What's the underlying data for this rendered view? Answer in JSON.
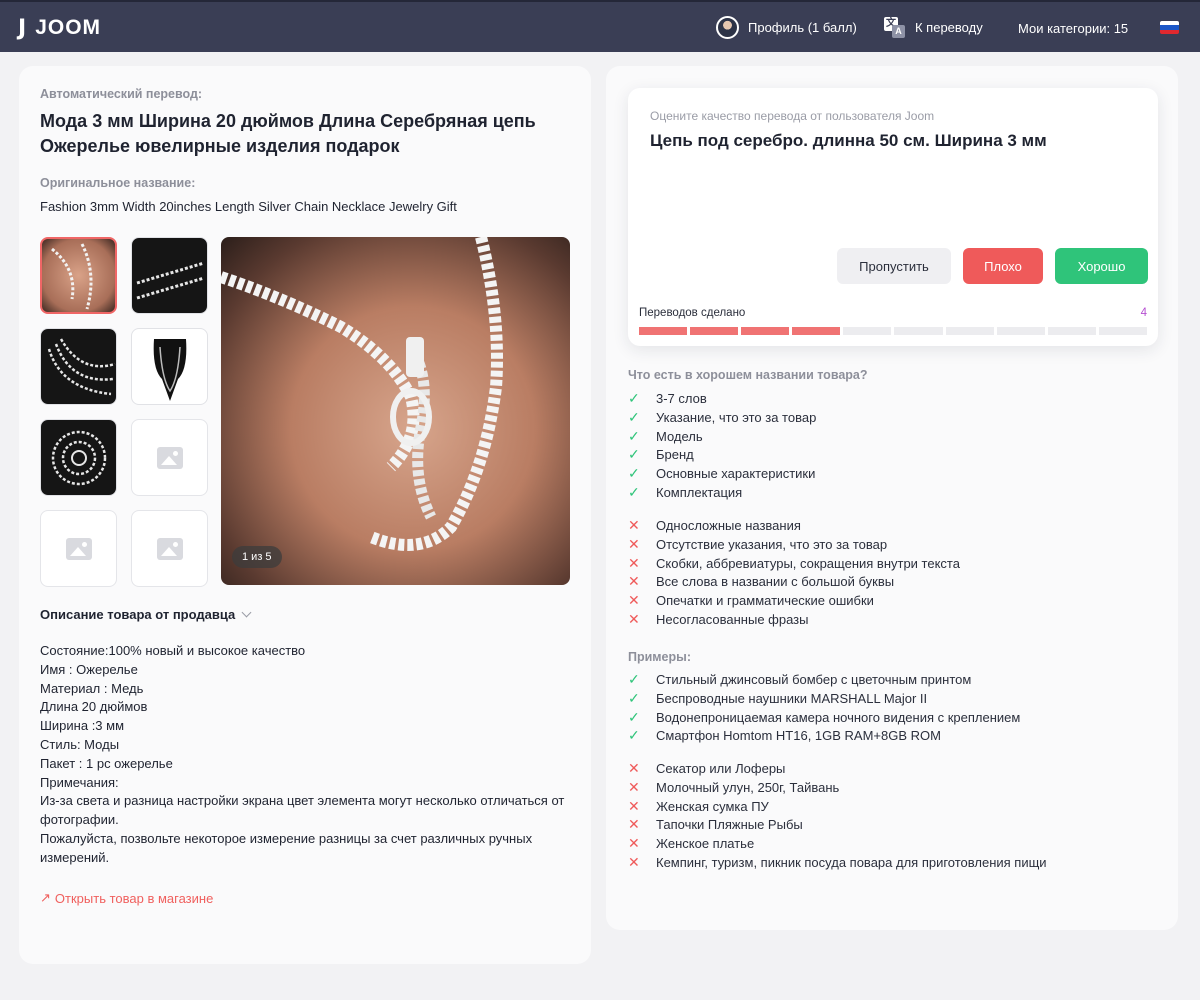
{
  "header": {
    "logo_text": "JOOM",
    "logo_mark": "J",
    "profile_label": "Профиль (1 балл)",
    "translate_label": "К переводу",
    "translate_icon_a": "文",
    "translate_icon_b": "A",
    "categories_label": "Мои категории: 15",
    "flag_colors": [
      "#ffffff",
      "#1c57c8",
      "#e0282e"
    ]
  },
  "product": {
    "auto_translation_label": "Автоматический перевод:",
    "title_ru": "Мода 3 мм Ширина 20 дюймов Длина Серебряная цепь Ожерелье ювелирные изделия подарок",
    "original_label": "Оригинальное название:",
    "title_en": "Fashion 3mm Width 20inches Length Silver Chain Necklace Jewelry Gift",
    "photo_counter": "1 из 5",
    "description_title": "Описание товара от продавца",
    "description_lines": [
      "Состояние:100% новый и высокое качество",
      "Имя : Ожерелье",
      "Материал : Медь",
      "Длина 20 дюймов",
      "Ширина :3 мм",
      "Стиль: Моды",
      "Пакет : 1 pc ожерелье",
      "Примечания:",
      "Из-за света и разница настройки экрана цвет элемента могут несколько отличаться от фотографии.",
      "Пожалуйста, позвольте некоторое измерение разницы за счет различных ручных измерений."
    ],
    "open_in_shop_label": "Открыть товар в магазине",
    "open_in_shop_arrow": "↗"
  },
  "rating": {
    "prompt": "Оцените качество перевода от пользователя Joom",
    "user_translation": "Цепь под серебро. длинна 50 см. Ширина 3 мм",
    "skip_label": "Пропустить",
    "bad_label": "Плохо",
    "good_label": "Хорошо",
    "progress_label": "Переводов сделано",
    "progress_count": "4",
    "progress_done": 4,
    "progress_total": 10
  },
  "guidelines": {
    "title": "Что есть в хорошем названии товара?",
    "good": [
      "3-7 слов",
      "Указание, что это за товар",
      "Модель",
      "Бренд",
      "Основные характеристики",
      "Комплектация"
    ],
    "bad": [
      "Односложные названия",
      "Отсутствие указания, что это за товар",
      "Скобки, аббревиатуры, сокращения внутри текста",
      "Все слова в названии с большой буквы",
      "Опечатки и грамматические ошибки",
      "Несогласованные фразы"
    ],
    "examples_title": "Примеры:",
    "examples_good": [
      "Стильный джинсовый бомбер с цветочным принтом",
      "Беспроводные наушники MARSHALL Major II",
      "Водонепроницаемая камера ночного видения с креплением",
      "Смартфон Homtom HT16, 1GB RAM+8GB ROM"
    ],
    "examples_bad": [
      "Секатор или Лоферы",
      "Молочный улун, 250г, Тайвань",
      "Женская сумка ПУ",
      "Тапочки Пляжные Рыбы",
      "Женское платье",
      "Кемпинг, туризм, пикник посуда повара для приготовления пищи"
    ],
    "check_glyph": "✓",
    "cross_glyph": "✕"
  }
}
